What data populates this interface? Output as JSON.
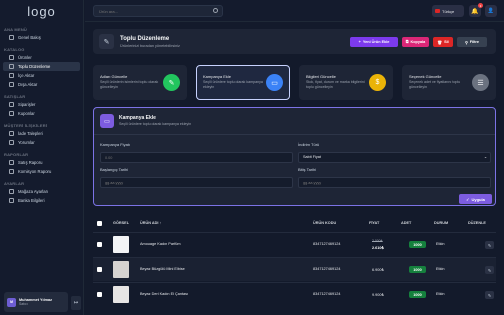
{
  "app": {
    "logo": "logo"
  },
  "sidebar": {
    "sections": [
      {
        "label": "ANA MENÜ",
        "items": [
          {
            "label": "Genel Bakış"
          }
        ]
      },
      {
        "label": "KATALOG",
        "items": [
          {
            "label": "Ürünler"
          },
          {
            "label": "Toplu Düzenleme"
          },
          {
            "label": "İçe Aktar"
          },
          {
            "label": "Dışa Aktar"
          }
        ]
      },
      {
        "label": "SATIŞLAR",
        "items": [
          {
            "label": "Siparişler"
          },
          {
            "label": "Kuponlar"
          }
        ]
      },
      {
        "label": "MÜŞTERİ İLİŞKİLERİ",
        "items": [
          {
            "label": "İade Talepleri"
          },
          {
            "label": "Yorumlar"
          }
        ]
      },
      {
        "label": "RAPORLAR",
        "items": [
          {
            "label": "Satış Raporu"
          },
          {
            "label": "Komisyon Raporu"
          }
        ]
      },
      {
        "label": "AYARLAR",
        "items": [
          {
            "label": "Mağaza Ayarları"
          },
          {
            "label": "Banka Bilgileri"
          }
        ]
      }
    ],
    "user": {
      "initials": "M",
      "name": "Muhammet Yılmaz",
      "role": "Satıcı"
    }
  },
  "topbar": {
    "search_placeholder": "Ürün ara...",
    "language": "Türkçe",
    "notification_count": "3"
  },
  "header": {
    "title": "Toplu Düzenleme",
    "subtitle": "Ürünlerinizi buradan yönetebilirsiniz",
    "buttons": {
      "new_product": "Yeni Ürün Ekle",
      "copy": "Kopyala",
      "delete": "Sil",
      "filter": "Filtre"
    }
  },
  "cards": [
    {
      "title": "Adları Güncelle",
      "desc": "Seçili ürünlerin isimlerini toplu olarak güncelleyin",
      "color": "#22c55e"
    },
    {
      "title": "Kampanya Ekle",
      "desc": "Seçili ürünlere toplu olarak kampanya ekleyin",
      "color": "#3b82f6"
    },
    {
      "title": "Bilgileri Güncelle",
      "desc": "Stok, fiyat, durum ve marka bilgilerini toplu güncelleyin",
      "color": "#eab308"
    },
    {
      "title": "Seçenek Güncelle",
      "desc": "Seçenek adet ve fiyatlarını toplu güncelleyin",
      "color": "#6b7280"
    }
  ],
  "panel": {
    "title": "Kampanya Ekle",
    "subtitle": "Seçili ürünlere toplu olarak kampanya ekleyin",
    "price_label": "Kampanya Fiyatı",
    "price_placeholder": "0.00",
    "discount_label": "İndirim Türü",
    "discount_value": "Sabit Fiyat",
    "start_label": "Başlangıç Tarihi",
    "start_placeholder": "gg.aa.yyyy",
    "end_label": "Bitiş Tarihi",
    "end_placeholder": "gg.aa.yyyy",
    "apply_label": "Uygula"
  },
  "table": {
    "columns": {
      "image": "GÖRSEL",
      "name": "ÜRÜN ADI ↑",
      "code": "ÜRÜN KODU",
      "price": "FİYAT",
      "qty": "ADET",
      "status": "DURUM",
      "edit": "DÜZENLE"
    },
    "rows": [
      {
        "name": "Amouage Kadın Parfüm",
        "code": "8347127469124",
        "old_price": "2.000₺",
        "price": "2.610₺",
        "qty": "1000",
        "status": "Etkin"
      },
      {
        "name": "Beyaz Büzgülü Mini Elbise",
        "code": "8347127469124",
        "old_price": "",
        "price": "6.900₺",
        "qty": "1000",
        "status": "Etkin"
      },
      {
        "name": "Beyaz Deri Kadın El Çantası",
        "code": "8347127469124",
        "old_price": "",
        "price": "9.900₺",
        "qty": "1000",
        "status": "Etkin"
      }
    ]
  }
}
